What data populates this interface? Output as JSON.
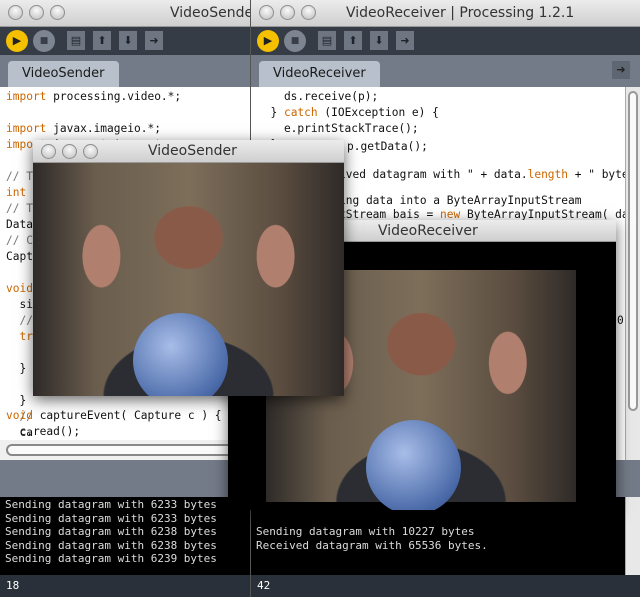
{
  "sender_editor": {
    "title": "VideoSender",
    "tab": "VideoSender",
    "code": [
      "import processing.video.*;",
      "",
      "import javax.imageio.*;",
      "import java.awt.image.*;",
      "",
      "// Th",
      "int c",
      "// Th",
      "Datag",
      "// Co",
      "Captu",
      "",
      "void",
      "  si",
      "  //",
      "  try",
      "    c",
      "  } c",
      "    e",
      "  }",
      "  //",
      "  ca",
      "}",
      "",
      "void captureEvent( Capture c ) {",
      "  c.read();"
    ],
    "console": [
      "Sending datagram with 6233 bytes",
      "Sending datagram with 6233 bytes",
      "Sending datagram with 6238 bytes",
      "Sending datagram with 6238 bytes",
      "Sending datagram with 6239 bytes"
    ],
    "line_number": "18"
  },
  "receiver_editor": {
    "title": "VideoReceiver | Processing 1.2.1",
    "tab": "VideoReceiver",
    "code": [
      "    ds.receive(p);",
      "  } catch (IOException e) {",
      "    e.printStackTrace();",
      "  }",
      "p.getData();",
      "ived datagram with \" + data.length + \" bytes.\" )",
      "ing data into a ByteArrayInputStream",
      "tStream bais = new ByteArrayInputStream( data );",
      "0"
    ],
    "console": [
      "Sending datagram with 10227 bytes",
      "Received datagram with 65536 bytes."
    ],
    "line_number": "42"
  },
  "sender_sketch": {
    "title": "VideoSender"
  },
  "receiver_sketch": {
    "title": "VideoReceiver"
  },
  "toolbar": {
    "run": "▶",
    "stop": "■",
    "new": "▤",
    "open": "⬆",
    "save": "⬇",
    "export": "➜"
  }
}
